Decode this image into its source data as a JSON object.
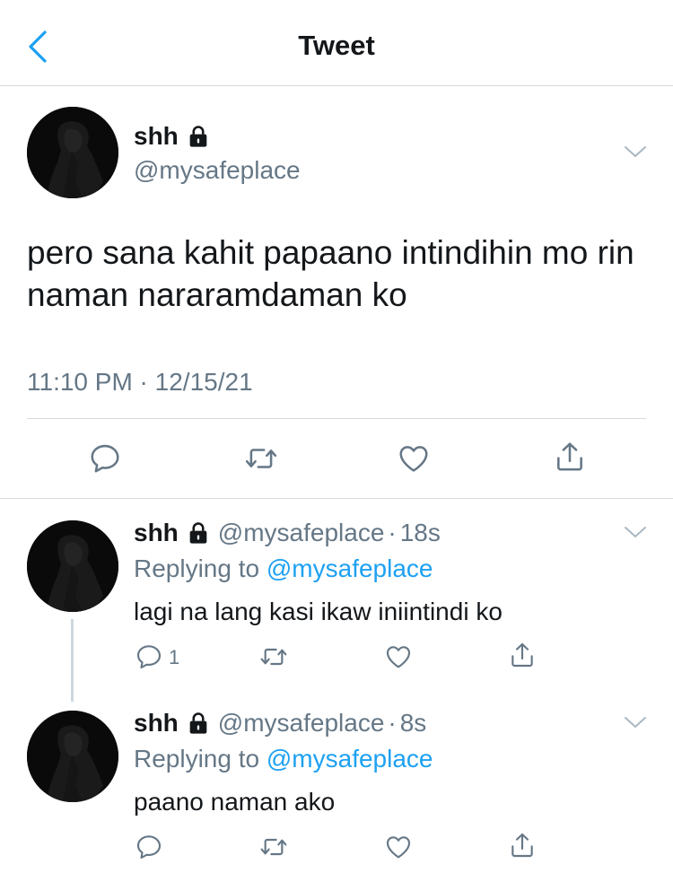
{
  "nav": {
    "title": "Tweet"
  },
  "main_tweet": {
    "name": "shh",
    "handle": "@mysafeplace",
    "text": "pero sana kahit papaano intindihin mo rin naman nararamdaman ko",
    "timestamp": "11:10 PM · 12/15/21"
  },
  "replies": [
    {
      "name": "shh",
      "handle": "@mysafeplace",
      "dot": "·",
      "time": "18s",
      "replying_prefix": "Replying to",
      "replying_to": "@mysafeplace",
      "text": "lagi na lang kasi ikaw iniintindi ko",
      "reply_count": "1"
    },
    {
      "name": "shh",
      "handle": "@mysafeplace",
      "dot": "·",
      "time": "8s",
      "replying_prefix": "Replying to",
      "replying_to": "@mysafeplace",
      "text": "paano naman ako"
    }
  ],
  "icons": {
    "back": "chevron-left-icon",
    "lock": "lock-icon",
    "reply": "comment-icon",
    "retweet": "retweet-icon",
    "like": "heart-icon",
    "share": "share-icon",
    "more": "chevron-down-icon"
  },
  "colors": {
    "accent": "#1da1f2",
    "secondary_text": "#657786",
    "primary_text": "#14171a",
    "divider": "#d5d9dd"
  }
}
